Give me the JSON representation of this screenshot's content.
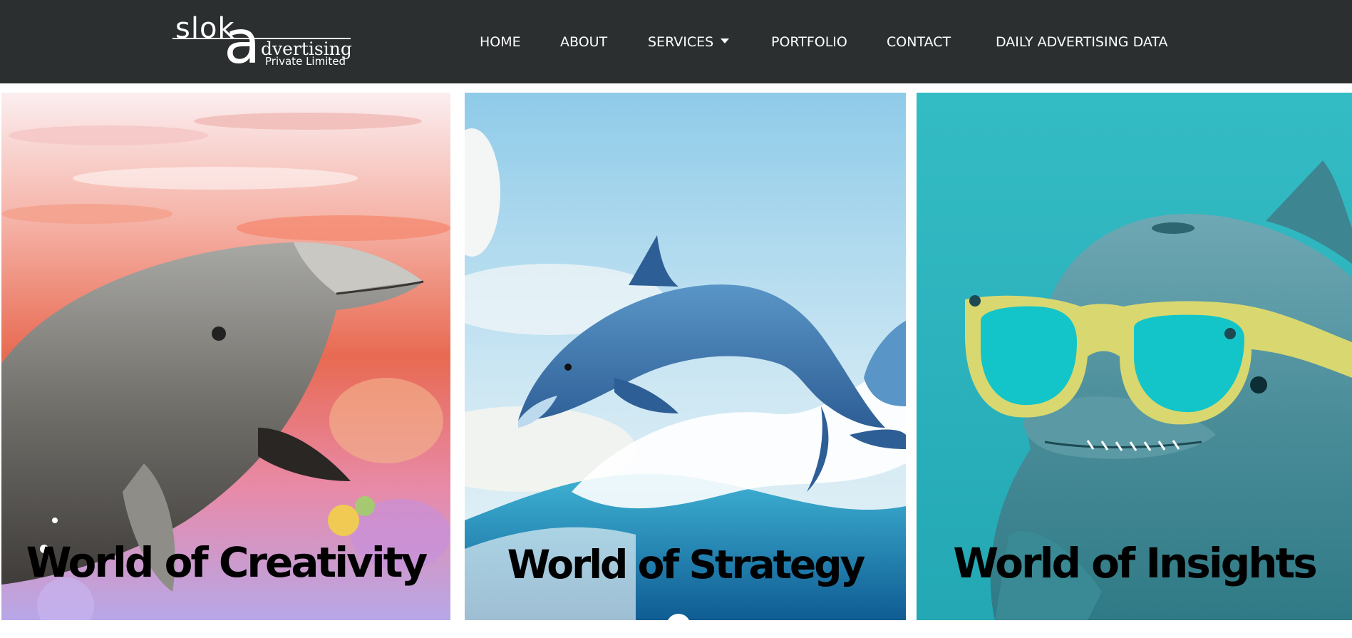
{
  "header": {
    "logo": {
      "text_sloka": "slok",
      "text_a": "a",
      "text_advertising": "dvertising",
      "text_private": "Private Limited"
    },
    "nav": {
      "items": [
        {
          "label": "HOME"
        },
        {
          "label": "ABOUT"
        },
        {
          "label": "SERVICES",
          "has_dropdown": true,
          "dropdown_icon": "caret-down-icon"
        },
        {
          "label": "PORTFOLIO"
        },
        {
          "label": "CONTACT"
        },
        {
          "label": "DAILY ADVERTISING DATA"
        }
      ]
    },
    "background_color": "#2b2f2f"
  },
  "panels": [
    {
      "title": "World of Creativity",
      "image": "dolphin-swimming-in-colorful-reef"
    },
    {
      "title": "World of Strategy",
      "image": "dolphin-jumping-over-waves"
    },
    {
      "title": "World of Insights",
      "image": "dolphin-wearing-yellow-sunglasses"
    }
  ],
  "colors": {
    "header_bg": "#2b2f2f",
    "nav_text": "#ffffff",
    "title_text": "#000000",
    "sky_blue": "#8ecbe8",
    "teal": "#2fb8c2"
  }
}
